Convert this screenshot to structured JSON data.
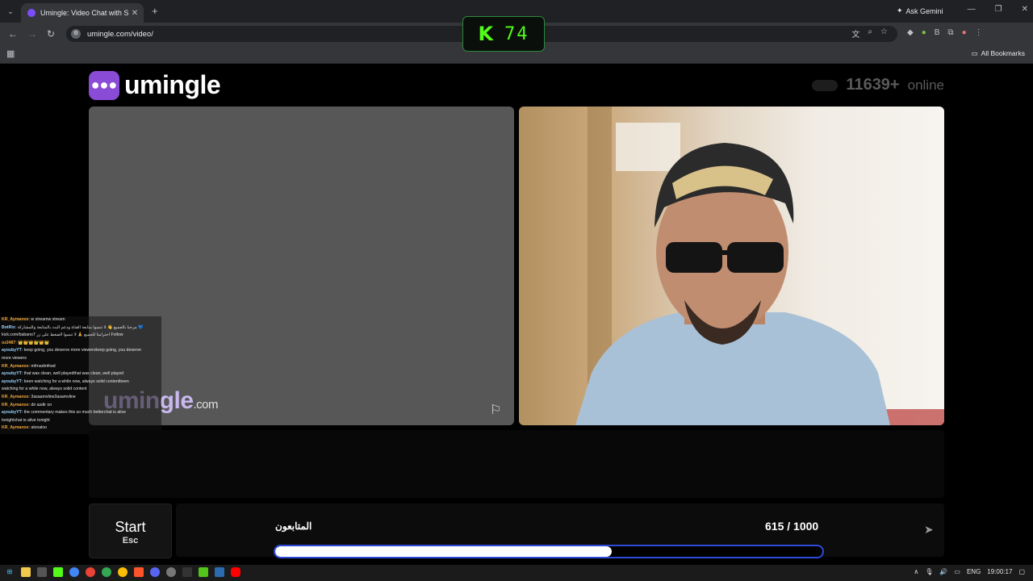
{
  "browser": {
    "tab_title": "Umingle: Video Chat with S",
    "tab_close": "✕",
    "new_tab": "+",
    "url": "umingle.com/video/",
    "ask_gemini": "Ask Gemini",
    "all_bookmarks": "All Bookmarks"
  },
  "kick_overlay": {
    "logo": "K",
    "viewers": "74"
  },
  "site": {
    "brand": "umingle",
    "online_count": "11639+",
    "online_label": "online",
    "watermark_name": "umingle",
    "watermark_tld": ".com"
  },
  "chat": [
    {
      "user": "KR_Aymanox",
      "msg": ": w streamw stream"
    },
    {
      "user": "BotRix",
      "msg": ": مرحبا بالجميع 👋 لا تنسوا متابعة القناة ودعم البث بالمتابعة والمشاركة 💙"
    },
    {
      "user": "",
      "msg": "kick.com/babano7 احترامنا للجميع 🙏 لا تنسوا الضغط على زر Follow"
    },
    {
      "user": "oz2487",
      "msg": ": 👑👑👑👑👑👑"
    },
    {
      "user": "ayoubyYT",
      "msg": ": keep going, you deserve more viewerskeep going, you deserve"
    },
    {
      "user": "",
      "msg": "more viewers"
    },
    {
      "user": "KR_Aymanox",
      "msg": ": mfrnadmfrwd"
    },
    {
      "user": "ayoubyYT",
      "msg": ": that was clean, well playedthat was clean, well played"
    },
    {
      "user": "ayoubyYT",
      "msg": ": been watching for a while now, always solid contentbeen"
    },
    {
      "user": "",
      "msg": "watching for a while now, always solid content"
    },
    {
      "user": "KR_Aymanox",
      "msg": ": 3asaamvline3asamvline"
    },
    {
      "user": "KR_Aymanox",
      "msg": ": dir asdir on"
    },
    {
      "user": "ayoubyYT",
      "msg": ": the commentary makes this so much betterchat is alive"
    },
    {
      "user": "",
      "msg": "tonightchat is alive tonight"
    },
    {
      "user": "KR_Aymanox",
      "msg": ": alooaloo"
    }
  ],
  "controls": {
    "start_label": "Start",
    "start_hint": "Esc",
    "followers_label": "المتابعون",
    "followers_count": "615 / 1000",
    "followers_progress": 0.615
  },
  "taskbar": {
    "lang": "ENG",
    "time": "19:00:17"
  },
  "colors": {
    "brand_purple": "#8a4bd6",
    "kick_green": "#53fc18",
    "progress_border": "#2d4bd8"
  }
}
